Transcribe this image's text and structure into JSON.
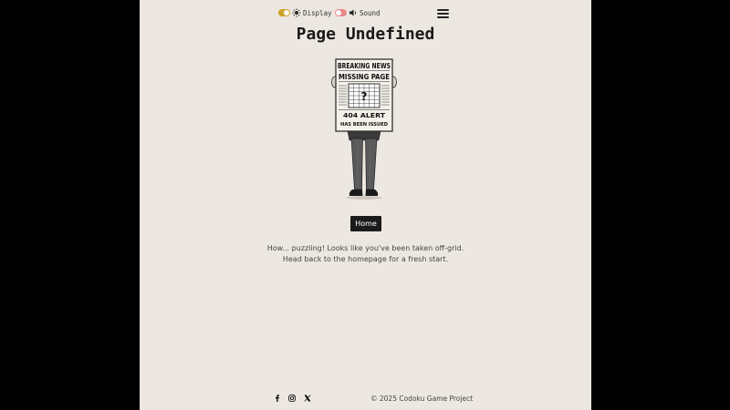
{
  "header": {
    "display_label": "Display",
    "sound_label": "Sound",
    "display_icon": "sun-icon",
    "sound_icon": "speaker-icon",
    "menu_icon": "hamburger-icon"
  },
  "main": {
    "title": "Page Undefined",
    "newspaper": {
      "headline1": "BREAKING NEWS",
      "headline2": "MISSING PAGE",
      "question": "?",
      "alert1": "404 ALERT",
      "alert2": "HAS BEEN ISSUED"
    },
    "home_button": "Home",
    "message_line1": "How... puzzling! Looks like you've been taken off-grid.",
    "message_line2": "Head back to the homepage for a fresh start."
  },
  "footer": {
    "social_icons": [
      "facebook-icon",
      "instagram-icon",
      "x-icon"
    ],
    "copyright": "© 2025 Codoku Game Project"
  },
  "colors": {
    "page_bg": "#ede7e1",
    "outer_bg": "#000000",
    "display_toggle_on": "#c9a227",
    "sound_toggle_off": "#e88a8a",
    "button_bg": "#1b1b1b"
  }
}
